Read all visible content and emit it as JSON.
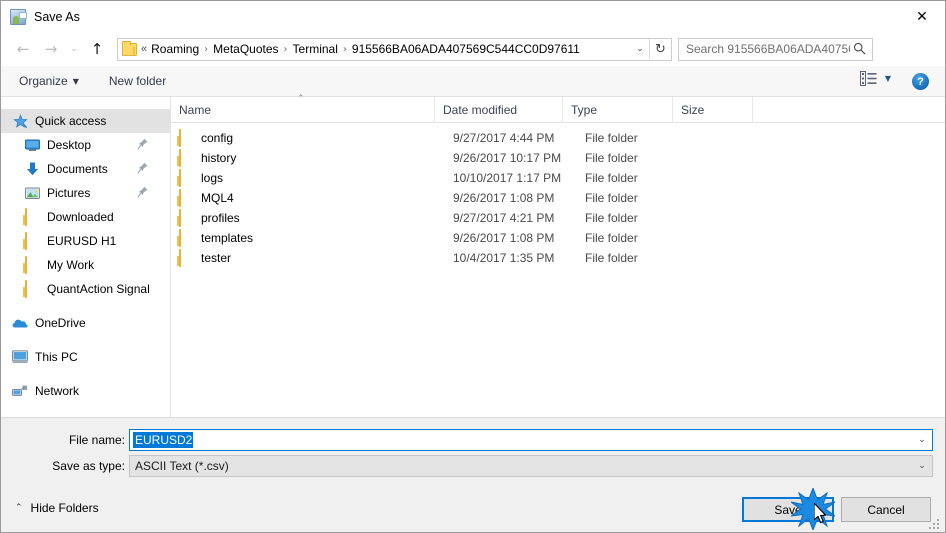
{
  "window": {
    "title": "Save As",
    "icon": "save-as-app-icon",
    "close_label": "✕"
  },
  "navbar": {
    "back_icon": "←",
    "forward_icon": "→",
    "recent_icon": "⌄",
    "up_icon": "↑",
    "address": {
      "lead": "«",
      "separator": "›",
      "crumbs": [
        "Roaming",
        "MetaQuotes",
        "Terminal",
        "915566BA06ADA407569C544CC0D97611"
      ],
      "dropdown_icon": "⌄",
      "refresh_icon": "↻"
    },
    "search": {
      "placeholder": "Search 915566BA06ADA40756…",
      "icon": "search-icon"
    }
  },
  "commandbar": {
    "organize_label": "Organize",
    "organize_caret": "▼",
    "new_folder_label": "New folder",
    "view_caret": "▼",
    "help_label": "?"
  },
  "sidebar": {
    "items": [
      {
        "label": "Quick access",
        "icon": "star-pin-icon",
        "selected": true,
        "indent": 0,
        "pinned": false,
        "group_top": false
      },
      {
        "label": "Desktop",
        "icon": "desktop-icon",
        "selected": false,
        "indent": 1,
        "pinned": true,
        "group_top": false
      },
      {
        "label": "Documents",
        "icon": "documents-down-arrow-icon",
        "selected": false,
        "indent": 1,
        "pinned": true,
        "group_top": false
      },
      {
        "label": "Pictures",
        "icon": "pictures-icon",
        "selected": false,
        "indent": 1,
        "pinned": true,
        "group_top": false
      },
      {
        "label": "Downloaded",
        "icon": "folder-icon",
        "selected": false,
        "indent": 1,
        "pinned": false,
        "group_top": false
      },
      {
        "label": "EURUSD H1",
        "icon": "folder-icon",
        "selected": false,
        "indent": 1,
        "pinned": false,
        "group_top": false
      },
      {
        "label": "My Work",
        "icon": "folder-icon",
        "selected": false,
        "indent": 1,
        "pinned": false,
        "group_top": false
      },
      {
        "label": "QuantAction Signal",
        "icon": "folder-icon",
        "selected": false,
        "indent": 1,
        "pinned": false,
        "group_top": false
      },
      {
        "label": "OneDrive",
        "icon": "onedrive-cloud-icon",
        "selected": false,
        "indent": 0,
        "pinned": false,
        "group_top": true
      },
      {
        "label": "This PC",
        "icon": "this-pc-monitor-icon",
        "selected": false,
        "indent": 0,
        "pinned": false,
        "group_top": true
      },
      {
        "label": "Network",
        "icon": "network-icon",
        "selected": false,
        "indent": 0,
        "pinned": false,
        "group_top": true
      }
    ]
  },
  "filelist": {
    "columns": {
      "name": "Name",
      "date_modified": "Date modified",
      "type": "Type",
      "size": "Size"
    },
    "sort_caret": "⌃",
    "rows": [
      {
        "name": "config",
        "date": "9/27/2017 4:44 PM",
        "type": "File folder",
        "size": ""
      },
      {
        "name": "history",
        "date": "9/26/2017 10:17 PM",
        "type": "File folder",
        "size": ""
      },
      {
        "name": "logs",
        "date": "10/10/2017 1:17 PM",
        "type": "File folder",
        "size": ""
      },
      {
        "name": "MQL4",
        "date": "9/26/2017 1:08 PM",
        "type": "File folder",
        "size": ""
      },
      {
        "name": "profiles",
        "date": "9/27/2017 4:21 PM",
        "type": "File folder",
        "size": ""
      },
      {
        "name": "templates",
        "date": "9/26/2017 1:08 PM",
        "type": "File folder",
        "size": ""
      },
      {
        "name": "tester",
        "date": "10/4/2017 1:35 PM",
        "type": "File folder",
        "size": ""
      }
    ]
  },
  "form": {
    "filename_label": "File name:",
    "filename_value": "EURUSD2",
    "filename_caret": "⌄",
    "filetype_label": "Save as type:",
    "filetype_value": "ASCII Text (*.csv)",
    "filetype_caret": "⌄"
  },
  "footer": {
    "hide_folders_label": "Hide Folders",
    "hide_folders_caret": "⌃",
    "save_label": "Save",
    "cancel_label": "Cancel"
  },
  "colors": {
    "accent": "#0078d7",
    "selection_bg": "#0078d7",
    "sidebar_selected_bg": "#e2e2e2",
    "folder_yellow": "#ffd867",
    "chrome_bg": "#f0f0f0",
    "help_blue": "#1c74bf"
  }
}
